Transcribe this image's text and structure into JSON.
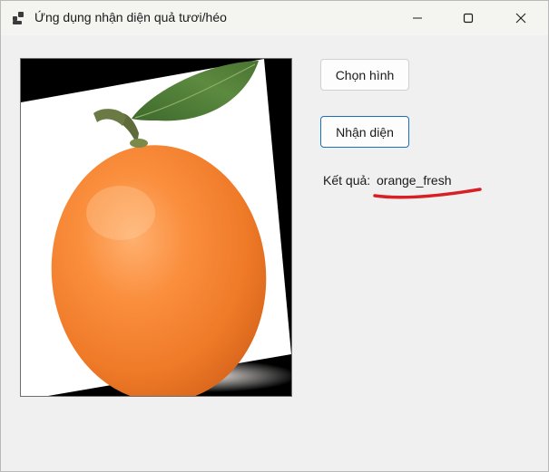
{
  "window": {
    "title": "Ứng dụng nhận diện quả tươi/héo",
    "controls": {
      "minimize_icon": "minimize-icon",
      "maximize_icon": "maximize-icon",
      "close_icon": "close-icon"
    }
  },
  "main": {
    "image_subject": "orange",
    "choose_button_label": "Chọn hình",
    "detect_button_label": "Nhận diện",
    "result_label": "Kết quả:",
    "result_value": "orange_fresh"
  },
  "colors": {
    "annotation_underline": "#d81f26",
    "focused_button_border": "#1a6fbd",
    "window_background": "#f0f0f0"
  }
}
